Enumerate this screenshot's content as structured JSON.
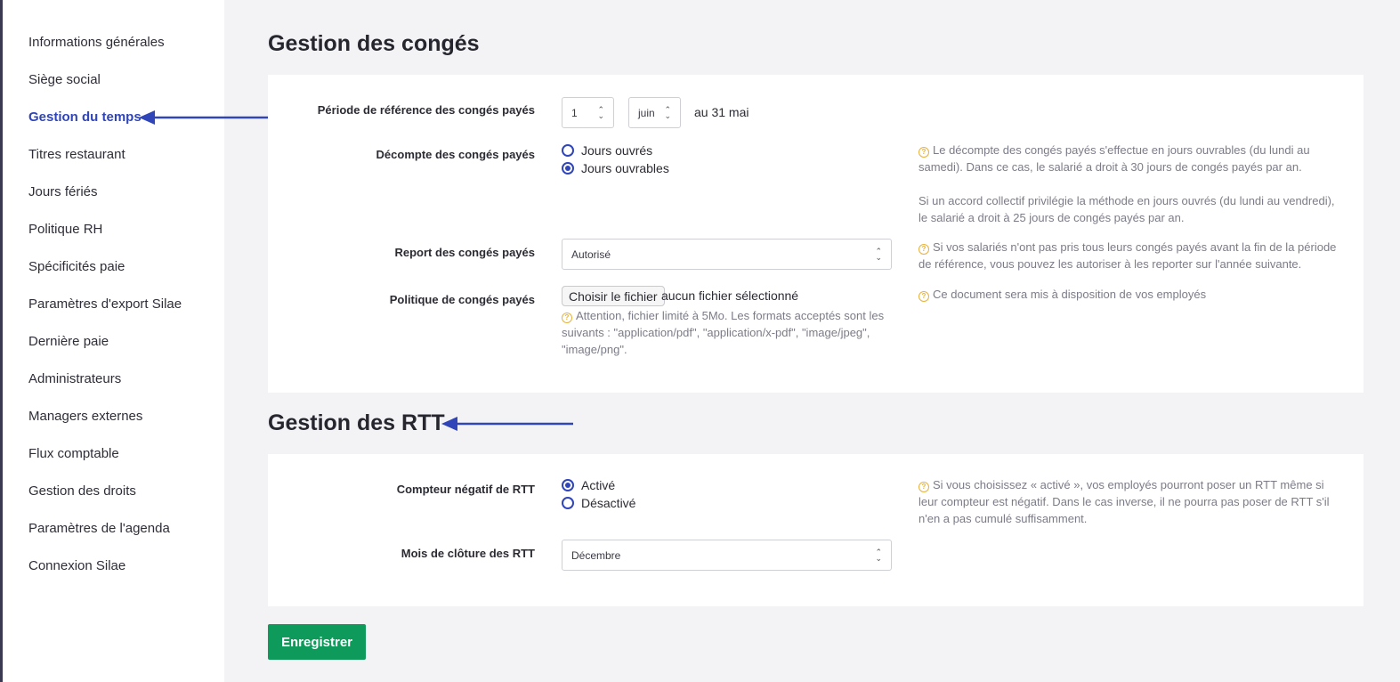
{
  "sidebar": {
    "items": [
      {
        "label": "Informations générales"
      },
      {
        "label": "Siège social"
      },
      {
        "label": "Gestion du temps"
      },
      {
        "label": "Titres restaurant"
      },
      {
        "label": "Jours fériés"
      },
      {
        "label": "Politique RH"
      },
      {
        "label": "Spécificités paie"
      },
      {
        "label": "Paramètres d'export Silae"
      },
      {
        "label": "Dernière paie"
      },
      {
        "label": "Administrateurs"
      },
      {
        "label": "Managers externes"
      },
      {
        "label": "Flux comptable"
      },
      {
        "label": "Gestion des droits"
      },
      {
        "label": "Paramètres de l'agenda"
      },
      {
        "label": "Connexion Silae"
      }
    ],
    "active_index": 2
  },
  "conges": {
    "title": "Gestion des congés",
    "periode": {
      "label": "Période de référence des congés payés",
      "day": "1",
      "month": "juin",
      "suffix": "au 31 mai"
    },
    "decompte": {
      "label": "Décompte des congés payés",
      "options": [
        {
          "label": "Jours ouvrés",
          "checked": false
        },
        {
          "label": "Jours ouvrables",
          "checked": true
        }
      ],
      "help_1": "Le décompte des congés payés s'effectue en jours ouvrables (du lundi au samedi). Dans ce cas, le salarié a droit à 30 jours de congés payés par an.",
      "help_2": "Si un accord collectif privilégie la méthode en jours ouvrés (du lundi au vendredi), le salarié a droit à 25 jours de congés payés par an."
    },
    "report": {
      "label": "Report des congés payés",
      "value": "Autorisé",
      "help": "Si vos salariés n'ont pas pris tous leurs congés payés avant la fin de la période de référence, vous pouvez les autoriser à les reporter sur l'année suivante."
    },
    "politique": {
      "label": "Politique de congés payés",
      "button": "Choisir le fichier",
      "no_file": "aucun fichier sélectionné",
      "note": "Attention, fichier limité à 5Mo. Les formats acceptés sont les suivants : \"application/pdf\", \"application/x-pdf\", \"image/jpeg\", \"image/png\".",
      "help": "Ce document sera mis à disposition de vos employés"
    }
  },
  "rtt": {
    "title": "Gestion des RTT",
    "compteur": {
      "label": "Compteur négatif de RTT",
      "options": [
        {
          "label": "Activé",
          "checked": true
        },
        {
          "label": "Désactivé",
          "checked": false
        }
      ],
      "help": "Si vous choisissez « activé », vos employés pourront poser un RTT même si leur compteur est négatif. Dans le cas inverse, il ne pourra pas poser de RTT s'il n'en a pas cumulé suffisamment."
    },
    "cloture": {
      "label": "Mois de clôture des RTT",
      "value": "Décembre"
    }
  },
  "save_label": "Enregistrer",
  "colors": {
    "accent": "#2f45b8",
    "save": "#0e9a5a",
    "help_icon": "#e8b23a"
  }
}
